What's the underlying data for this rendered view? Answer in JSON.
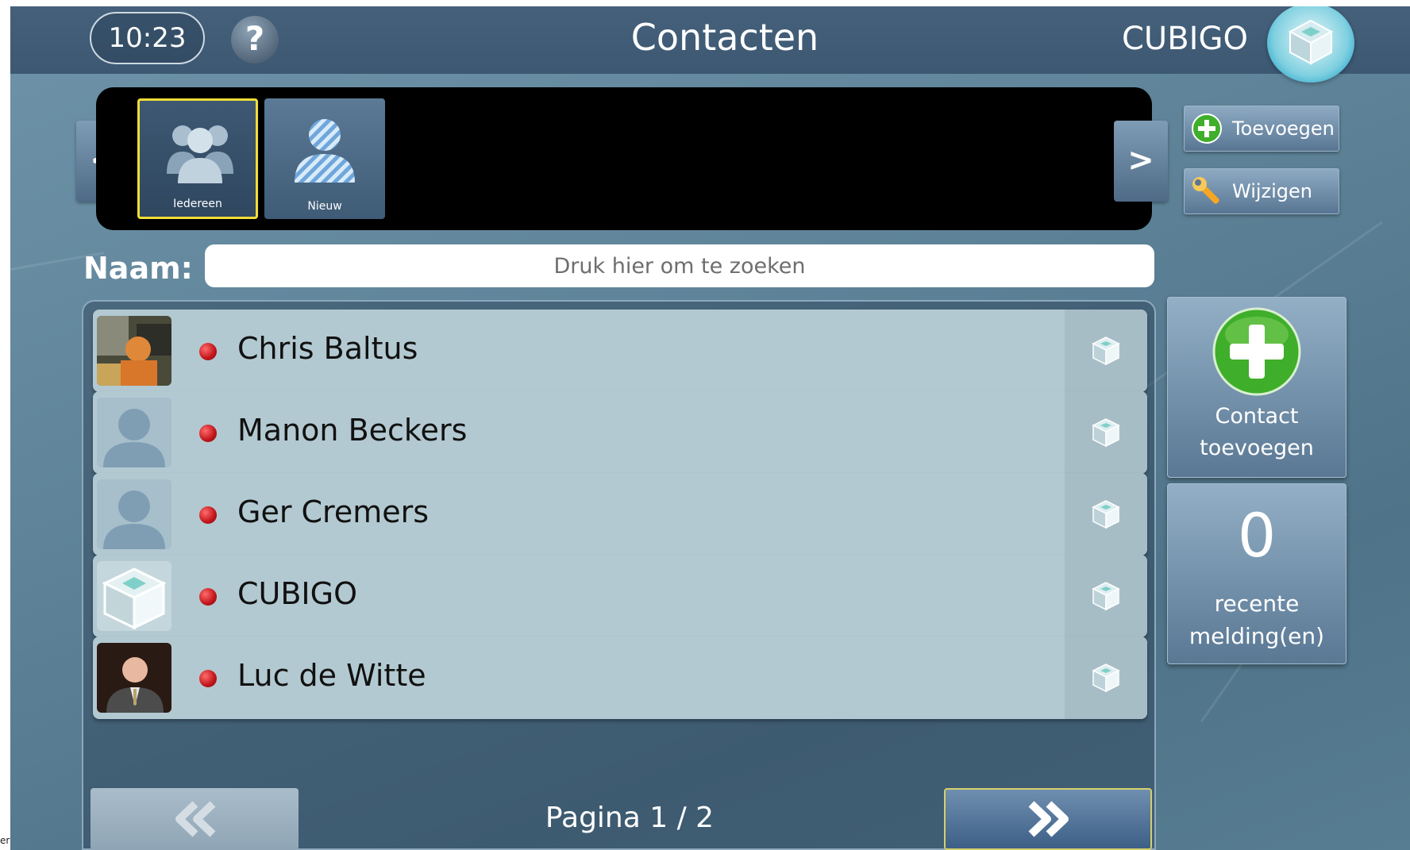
{
  "header": {
    "time": "10:23",
    "help_glyph": "?",
    "title": "Contacten",
    "brand": "CUBIGO"
  },
  "carousel": {
    "prev_glyph": "<",
    "next_glyph": ">",
    "groups": [
      {
        "label": "Iedereen",
        "icon": "group-icon",
        "selected": true
      },
      {
        "label": "Nieuw",
        "icon": "new-person-icon",
        "selected": false
      }
    ]
  },
  "actions": {
    "add_label": "Toevoegen",
    "edit_label": "Wijzigen"
  },
  "search": {
    "label": "Naam:",
    "placeholder": "Druk hier om te zoeken"
  },
  "contacts": [
    {
      "name": "Chris Baltus",
      "status": "offline",
      "avatar": "photo"
    },
    {
      "name": "Manon Beckers",
      "status": "offline",
      "avatar": "default-person"
    },
    {
      "name": "Ger Cremers",
      "status": "offline",
      "avatar": "default-person"
    },
    {
      "name": "CUBIGO",
      "status": "offline",
      "avatar": "cubigo-logo"
    },
    {
      "name": "Luc de Witte",
      "status": "offline",
      "avatar": "photo"
    }
  ],
  "add_contact": {
    "line1": "Contact",
    "line2": "toevoegen"
  },
  "notifications": {
    "count": "0",
    "line1": "recente",
    "line2": "melding(en)"
  },
  "pagination": {
    "text": "Pagina 1 / 2"
  },
  "footer": {
    "text": "er"
  },
  "colors": {
    "accent_yellow": "#f1dd39",
    "status_red": "#c0141a",
    "add_green": "#3fae2a"
  }
}
